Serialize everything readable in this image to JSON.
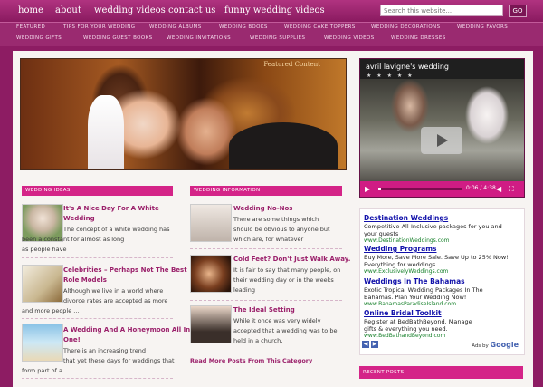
{
  "nav": {
    "items": [
      "home",
      "about",
      "wedding videos",
      "contact us",
      "funny wedding videos"
    ],
    "search_placeholder": "Search this website...",
    "search_button": "GO"
  },
  "categories": {
    "row1": [
      "FEATURED",
      "TIPS FOR YOUR WEDDING",
      "WEDDING ALBUMS",
      "WEDDING BOOKS",
      "WEDDING CAKE TOPPERS",
      "WEDDING DECORATIONS",
      "WEDDING FAVORS"
    ],
    "row2": [
      "WEDDING GIFTS",
      "WEDDING GUEST BOOKS",
      "WEDDING INVITATIONS",
      "WEDDING SUPPLIES",
      "WEDDING VIDEOS",
      "WEDDING DRESSES"
    ]
  },
  "featured": {
    "label": "Featured Content"
  },
  "video": {
    "title": "avril lavigne's wedding",
    "stars": "★ ★ ★ ★ ★",
    "time": "0:06 / 4:38",
    "progress": 0.03
  },
  "wedding_ideas": {
    "heading": "WEDDING IDEAS",
    "posts": [
      {
        "title": "It's A Nice Day For A White",
        "title2": "Wedding",
        "lines": [
          "The concept of a white wedding has",
          "been a constant for almost as long",
          "as people have"
        ]
      },
      {
        "title": "Celebrities – Perhaps Not The Best",
        "title2": "Role Models",
        "lines": [
          "Although we live in a world where",
          "divorce rates are accepted as more",
          "and more people ..."
        ]
      },
      {
        "title": "A Wedding And A Honeymoon All In",
        "title2": "One!",
        "lines": [
          "There is an increasing trend",
          "that yet these days for weddings that",
          "form part of a..."
        ]
      }
    ]
  },
  "wedding_information": {
    "heading": "WEDDING INFORMATION",
    "posts": [
      {
        "title": "Wedding No-Nos",
        "lines": [
          "There are some things which",
          "should be obvious to anyone but",
          "which are, for whatever"
        ]
      },
      {
        "title": "Cold Feet? Don't Just Walk Away.",
        "lines": [
          "It is fair to say that many people, on",
          "their wedding day or in the weeks",
          "leading"
        ]
      },
      {
        "title": "The Ideal Setting",
        "lines": [
          "While it once was very widely",
          "accepted that a wedding was to be",
          "held in a church,"
        ]
      }
    ],
    "read_more": "Read More Posts From This Category"
  },
  "ads": [
    {
      "title": "Destination Weddings",
      "lines": [
        "Competitive All-Inclusive packages for you and",
        "your guests"
      ],
      "url": "www.DestinationWeddings.com"
    },
    {
      "title": "Wedding Programs",
      "lines": [
        "Buy More, Save More Sale. Save Up to 25% Now!",
        "Everything for weddings."
      ],
      "url": "www.ExclusivelyWeddings.com"
    },
    {
      "title": "Weddings In The Bahamas",
      "lines": [
        "Exotic Tropical Wedding Packages In The",
        "Bahamas. Plan Your Wedding Now!"
      ],
      "url": "www.BahamasParadiseIsland.com"
    },
    {
      "title": "Online Bridal Toolkit",
      "lines": [
        "Register at BedBathBeyond. Manage",
        "gifts & everything you need."
      ],
      "url": "www.BedBathandBeyond.com"
    }
  ],
  "ads_by": "Ads by",
  "ads_brand": "Google",
  "recent_posts": {
    "heading": "RECENT POSTS"
  },
  "colors": {
    "accent": "#d42488",
    "nav_bg": "#8d1c63",
    "link": "#1111aa"
  }
}
